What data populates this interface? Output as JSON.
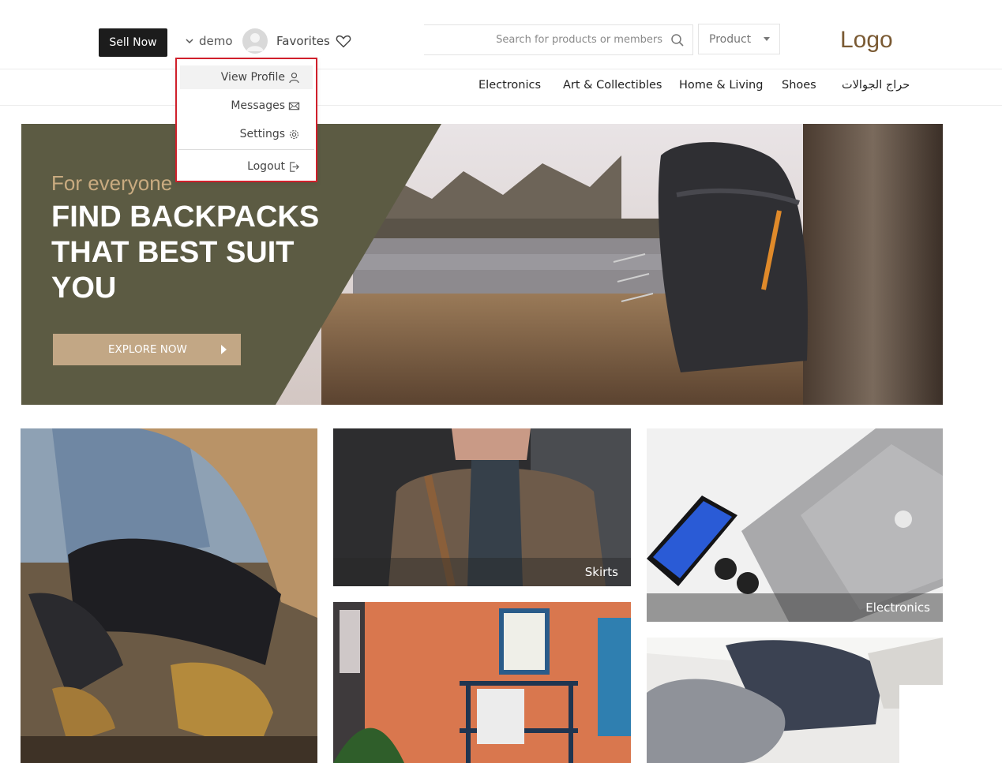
{
  "header": {
    "sell_now": "Sell Now",
    "username": "demo",
    "favorites": "Favorites",
    "search_placeholder": "Search for products or members",
    "product_select": "Product",
    "logo": "Logo"
  },
  "nav": {
    "items": [
      "Electronics",
      "Art & Collectibles",
      "Home & Living",
      "Shoes",
      "حراج الجوالات"
    ]
  },
  "user_menu": {
    "items": [
      {
        "label": "View Profile",
        "icon": "user-icon"
      },
      {
        "label": "Messages",
        "icon": "envelope-icon"
      },
      {
        "label": "Settings",
        "icon": "gear-icon"
      },
      {
        "label": "Logout",
        "icon": "logout-icon"
      }
    ],
    "highlight_color": "#d0202b"
  },
  "hero": {
    "eyebrow": "For everyone",
    "title": "FIND BACKPACKS THAT BEST SUIT YOU",
    "cta": "EXPLORE NOW",
    "panel_color": "#5c5b43",
    "cta_color": "#c2a785"
  },
  "tiles": [
    {
      "caption": ""
    },
    {
      "caption": "Skirts"
    },
    {
      "caption": "Electronics"
    },
    {
      "caption": ""
    },
    {
      "caption": ""
    }
  ]
}
